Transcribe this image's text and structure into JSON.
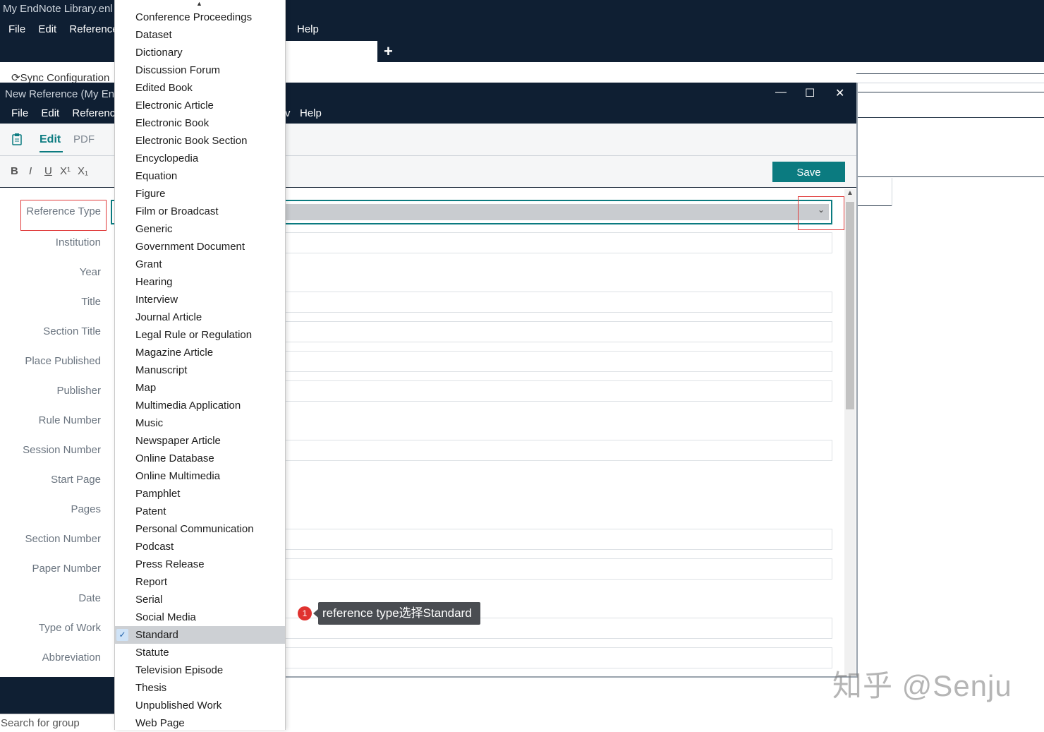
{
  "main_window": {
    "title": "My EndNote Library.enl",
    "menu": [
      "File",
      "Edit",
      "References"
    ],
    "help": "Help",
    "plus": "+",
    "sync_text": "Sync Configuration"
  },
  "ref_window": {
    "title": "New Reference (My En",
    "menu": [
      "File",
      "Edit",
      "Reference"
    ],
    "menu_partial": "v",
    "help": "Help",
    "controls": {
      "minimize": "—",
      "maximize": "☐",
      "close": "✕"
    },
    "tabs": {
      "edit": "Edit",
      "pdf": "PDF"
    },
    "format_buttons": [
      "B",
      "I",
      "U",
      "X¹",
      "X₁"
    ],
    "save_label": "Save",
    "search_placeholder": "Search for group"
  },
  "fields": [
    "Reference Type",
    "Institution",
    "Year",
    "Title",
    "Section Title",
    "Place Published",
    "Publisher",
    "Rule Number",
    "Session Number",
    "Start Page",
    "Pages",
    "Section Number",
    "Paper Number",
    "Date",
    "Type of Work",
    "Abbreviation"
  ],
  "dropdown": {
    "items": [
      "Conference Proceedings",
      "Dataset",
      "Dictionary",
      "Discussion Forum",
      "Edited Book",
      "Electronic Article",
      "Electronic Book",
      "Electronic Book Section",
      "Encyclopedia",
      "Equation",
      "Figure",
      "Film or Broadcast",
      "Generic",
      "Government Document",
      "Grant",
      "Hearing",
      "Interview",
      "Journal Article",
      "Legal Rule or Regulation",
      "Magazine Article",
      "Manuscript",
      "Map",
      "Multimedia Application",
      "Music",
      "Newspaper Article",
      "Online Database",
      "Online Multimedia",
      "Pamphlet",
      "Patent",
      "Personal Communication",
      "Podcast",
      "Press Release",
      "Report",
      "Serial",
      "Social Media",
      "Standard",
      "Statute",
      "Television Episode",
      "Thesis",
      "Unpublished Work",
      "Web Page"
    ],
    "selected": "Standard"
  },
  "annotation": {
    "badge": "1",
    "text": "reference type选择Standard"
  },
  "watermark": "知乎 @Senju",
  "colors": {
    "titlebar": "#0f1f33",
    "accent": "#0b7b80",
    "highlight_border": "#e03a3a"
  }
}
